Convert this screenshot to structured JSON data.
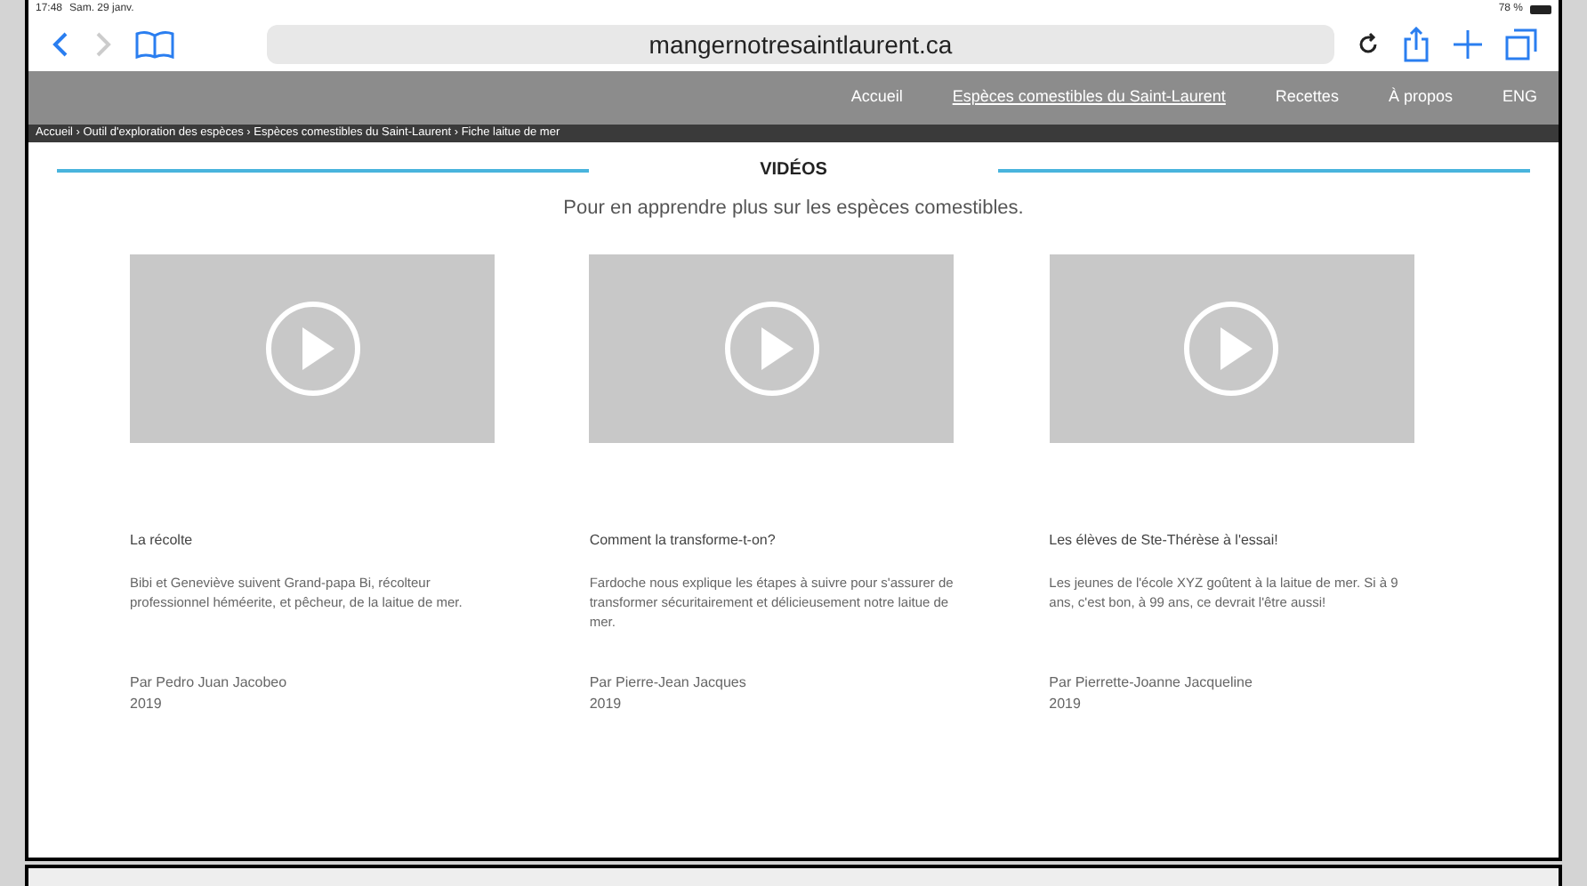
{
  "status_bar": {
    "time": "17:48",
    "date": "Sam. 29 janv.",
    "battery": "78 %"
  },
  "browser": {
    "url": "mangernotresaintlaurent.ca"
  },
  "nav": {
    "items": [
      {
        "label": "Accueil",
        "selected": false
      },
      {
        "label": "Espèces comestibles du Saint-Laurent",
        "selected": true
      },
      {
        "label": "Recettes",
        "selected": false
      },
      {
        "label": "À propos",
        "selected": false
      },
      {
        "label": "ENG",
        "selected": false
      }
    ]
  },
  "breadcrumb": "Accueil › Outil d'exploration des espèces › Espèces comestibles du Saint-Laurent › Fiche laitue de mer",
  "section": {
    "title": "VIDÉOS",
    "subtitle": "Pour en apprendre plus sur les espèces comestibles."
  },
  "videos": [
    {
      "title": "La récolte",
      "description": "Bibi et Geneviève suivent Grand-papa Bi, récolteur professionnel héméerite, et pêcheur, de la laitue de mer.",
      "author": "Par Pedro Juan Jacobeo",
      "year": "2019"
    },
    {
      "title": "Comment la transforme-t-on?",
      "description": "Fardoche nous explique les étapes à suivre pour s'assurer de transformer sécuritairement et délicieusement notre laitue de mer.",
      "author": "Par Pierre-Jean Jacques",
      "year": "2019"
    },
    {
      "title": "Les élèves de Ste-Thérèse à l'essai!",
      "description": "Les jeunes de l'école XYZ goûtent à la laitue de mer. Si à 9 ans, c'est bon, à 99 ans, ce devrait l'être aussi!",
      "author": "Par Pierrette-Joanne Jacqueline",
      "year": "2019"
    }
  ]
}
